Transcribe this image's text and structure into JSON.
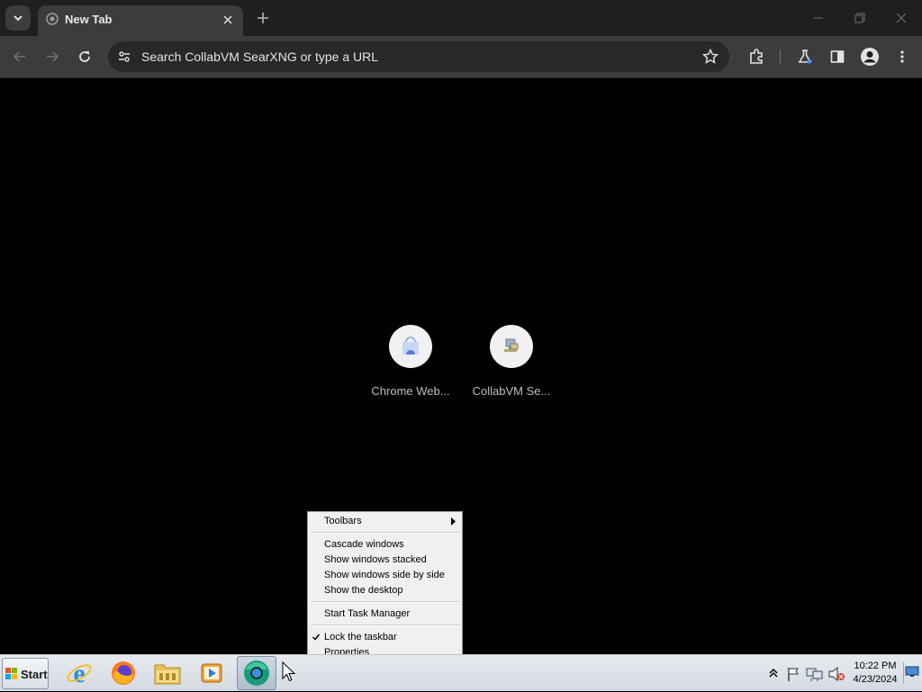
{
  "browser": {
    "tab": {
      "title": "New Tab"
    },
    "omnibox": {
      "placeholder": "Search CollabVM SearXNG or type a URL"
    },
    "shortcuts": [
      {
        "label": "Chrome Web..."
      },
      {
        "label": "CollabVM Se..."
      }
    ]
  },
  "context_menu": {
    "items": [
      {
        "label": "Toolbars",
        "submenu": true
      },
      {
        "label": "Cascade windows"
      },
      {
        "label": "Show windows stacked"
      },
      {
        "label": "Show windows side by side"
      },
      {
        "label": "Show the desktop"
      },
      {
        "label": "Start Task Manager"
      },
      {
        "label": "Lock the taskbar",
        "checked": true
      },
      {
        "label": "Properties"
      }
    ]
  },
  "taskbar": {
    "start_label": "Start",
    "apps": [
      "internet-explorer-icon",
      "firefox-icon",
      "file-explorer-icon",
      "media-player-icon",
      "chrome-icon"
    ],
    "clock": {
      "time": "10:22 PM",
      "date": "4/23/2024"
    }
  },
  "colors": {
    "chrome_tabstrip": "#1f1f1f",
    "chrome_toolbar": "#3c3c3c",
    "ntp_background": "#000000",
    "menu_background": "#f0f0f0",
    "taskbar": "#dde3ea"
  }
}
